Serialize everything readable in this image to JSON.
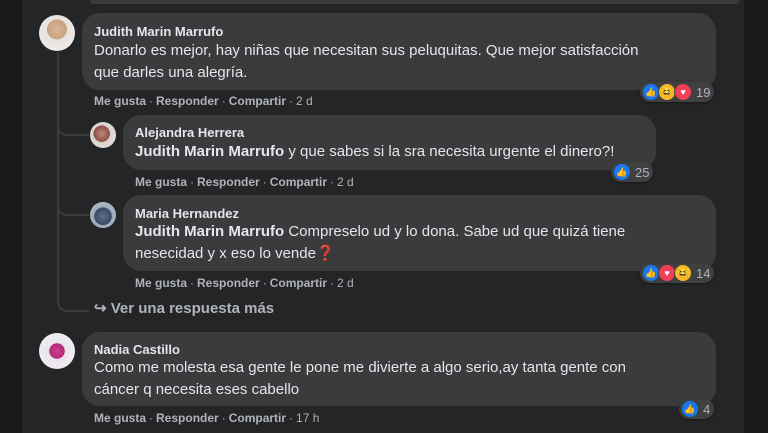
{
  "comments": [
    {
      "author": "Judith Marin Marrufo",
      "text_lines": [
        "Donarlo es mejor, hay niñas que necesitan sus peluquitas. Que mejor satisfacción",
        "que darles una alegría."
      ],
      "actions": {
        "like": "Me gusta",
        "reply": "Responder",
        "share": "Compartir",
        "time": "2 d"
      },
      "reaction_count": "19",
      "reactions": [
        "like-icon",
        "haha-icon",
        "love-icon"
      ]
    },
    {
      "author": "Alejandra Herrera",
      "mention": "Judith Marin Marrufo",
      "text": " y que sabes si la sra necesita urgente el dinero?!",
      "actions": {
        "like": "Me gusta",
        "reply": "Responder",
        "share": "Compartir",
        "time": "2 d"
      },
      "reaction_count": "25",
      "reactions": [
        "like-icon"
      ]
    },
    {
      "author": "Maria Hernandez",
      "mention": "Judith Marin Marrufo",
      "text_line1": " Compreselo ud y lo dona. Sabe ud que quizá tiene",
      "text_line2": "nesecidad y x eso lo vende❓",
      "actions": {
        "like": "Me gusta",
        "reply": "Responder",
        "share": "Compartir",
        "time": "2 d"
      },
      "reaction_count": "14",
      "reactions": [
        "like-icon",
        "love-icon",
        "haha-icon"
      ]
    },
    {
      "author": "Nadia Castillo",
      "text_lines": [
        "Como me molesta esa gente le pone me divierte a algo serio,ay tanta gente con",
        "cáncer q necesita eses cabello"
      ],
      "actions": {
        "like": "Me gusta",
        "reply": "Responder",
        "share": "Compartir",
        "time": "17 h"
      },
      "reaction_count": "4",
      "reactions": [
        "like-icon"
      ]
    }
  ],
  "more_replies": "↪ Ver una respuesta más",
  "colors": {
    "background": "#18191a",
    "bubble": "#3a3b3c",
    "text": "#e4e6eb",
    "muted": "#b0b3b8",
    "like": "#1877f2"
  }
}
